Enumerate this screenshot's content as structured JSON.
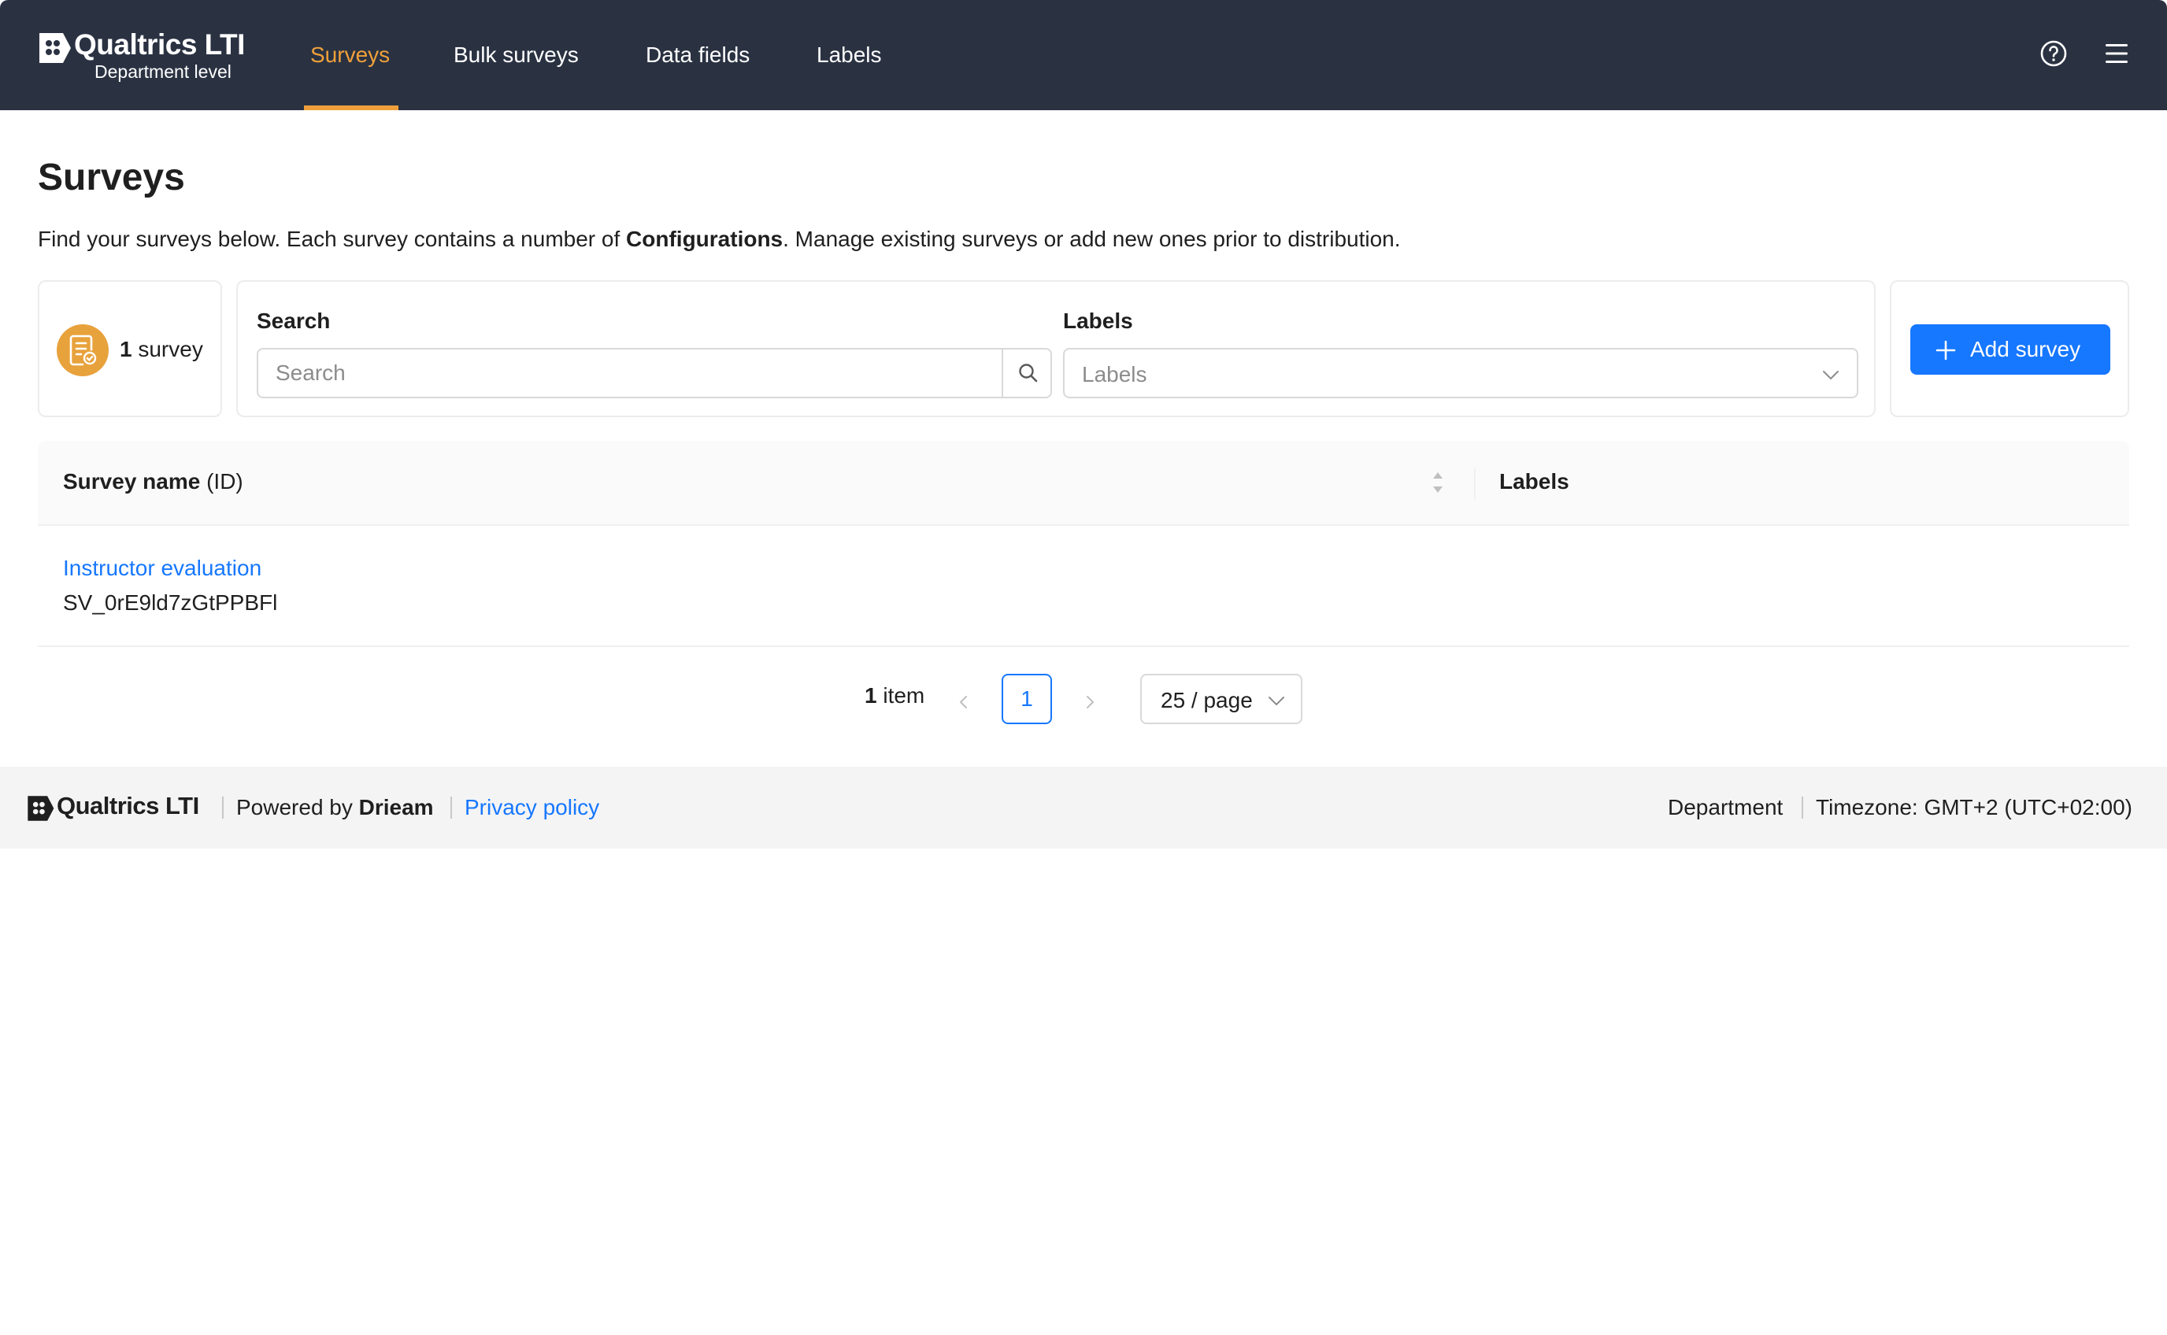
{
  "colors": {
    "nav_background": "#2a3242",
    "accent_active": "#f0a03a",
    "primary": "#1677ff",
    "badge": "#e8a23c",
    "footer_background": "#f4f4f5"
  },
  "brand": {
    "name": "Qualtrics LTI",
    "subtitle": "Department level",
    "logo_icon": "qualtrics-logo-icon"
  },
  "nav": {
    "items": [
      {
        "label": "Surveys",
        "active": true
      },
      {
        "label": "Bulk surveys",
        "active": false
      },
      {
        "label": "Data fields",
        "active": false
      },
      {
        "label": "Labels",
        "active": false
      }
    ],
    "right_icons": [
      "help-icon",
      "menu-icon"
    ]
  },
  "page": {
    "title": "Surveys",
    "description_before": "Find your surveys below. Each survey contains a number of ",
    "description_bold": "Configurations",
    "description_after": ". Manage existing surveys or add new ones prior to distribution."
  },
  "summary": {
    "count": "1",
    "unit": " survey",
    "icon": "survey-document-icon"
  },
  "filters": {
    "search_label": "Search",
    "search_placeholder": "Search",
    "search_value": "",
    "labels_label": "Labels",
    "labels_placeholder": "Labels"
  },
  "actions": {
    "add_survey_label": "Add survey"
  },
  "table": {
    "columns": {
      "name_bold": "Survey name",
      "name_suffix": " (ID)",
      "labels": "Labels"
    },
    "rows": [
      {
        "name": "Instructor evaluation",
        "id": "SV_0rE9ld7zGtPPBFl",
        "labels": ""
      }
    ]
  },
  "pagination": {
    "total_count": "1",
    "total_unit": " item",
    "current_page": "1",
    "page_size": "25 / page"
  },
  "footer": {
    "brand": "Qualtrics LTI",
    "powered_by_prefix": "Powered by ",
    "powered_by_name": "Drieam",
    "privacy_label": "Privacy policy",
    "context": "Department",
    "timezone": "Timezone: GMT+2 (UTC+02:00)"
  }
}
